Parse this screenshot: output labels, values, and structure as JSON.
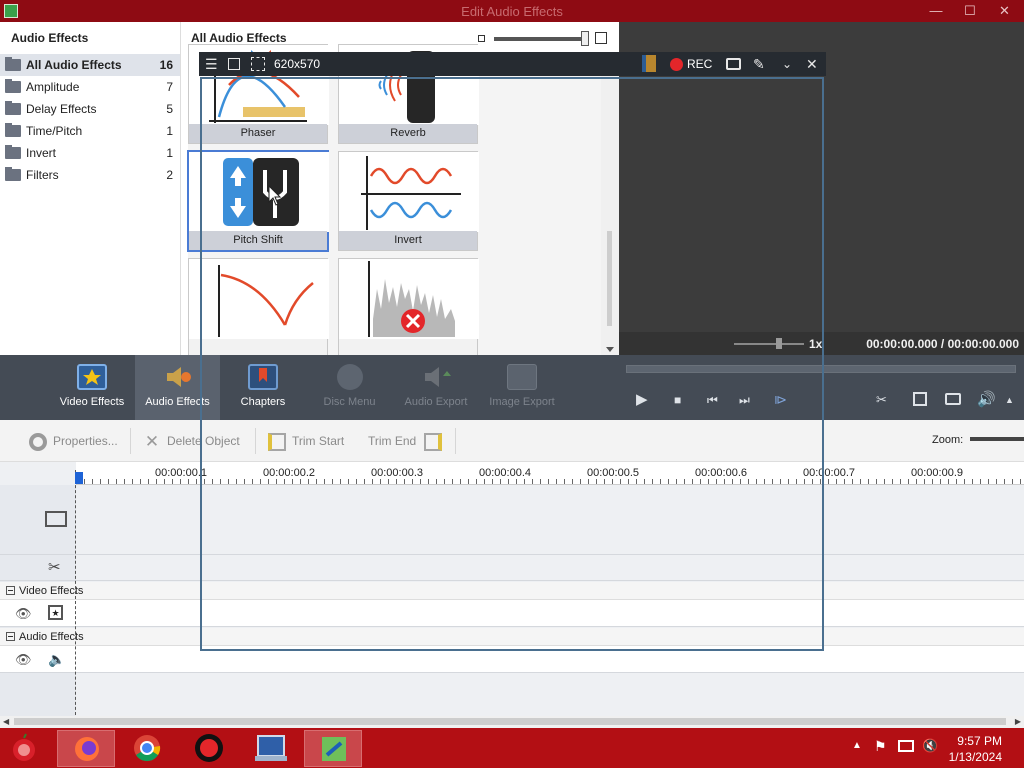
{
  "window": {
    "title": "Edit Audio Effects",
    "minimize": "—",
    "maximize": "☐",
    "close": "✕"
  },
  "categories": {
    "header": "Audio Effects",
    "items": [
      {
        "label": "All Audio Effects",
        "count": "16"
      },
      {
        "label": "Amplitude",
        "count": "7"
      },
      {
        "label": "Delay Effects",
        "count": "5"
      },
      {
        "label": "Time/Pitch",
        "count": "1"
      },
      {
        "label": "Invert",
        "count": "1"
      },
      {
        "label": "Filters",
        "count": "2"
      }
    ]
  },
  "effects": {
    "header": "All Audio Effects",
    "tiles": [
      {
        "label": "Phaser",
        "icon": "phaser-icon"
      },
      {
        "label": "Reverb",
        "icon": "reverb-icon"
      },
      {
        "label": "Pitch Shift",
        "icon": "tuning-fork-icon"
      },
      {
        "label": "Invert",
        "icon": "invert-wave-icon"
      },
      {
        "label": "",
        "icon": "filter-curve-icon"
      },
      {
        "label": "",
        "icon": "noise-remove-icon"
      }
    ]
  },
  "preview": {
    "speed": "1x",
    "time": "00:00:00.000 / 00:00:00.000"
  },
  "toolbar": {
    "tabs": [
      {
        "label": "Video Effects",
        "icon": "video-effects-icon"
      },
      {
        "label": "Audio Effects",
        "icon": "audio-effects-icon"
      },
      {
        "label": "Chapters",
        "icon": "chapters-icon"
      },
      {
        "label": "Disc Menu",
        "icon": "disc-menu-icon"
      },
      {
        "label": "Audio Export",
        "icon": "audio-export-icon"
      },
      {
        "label": "Image Export",
        "icon": "image-export-icon"
      }
    ],
    "controls": {
      "play": "▶",
      "stop": "■",
      "prev": "⏮",
      "next": "⏭",
      "frame": "⧐"
    }
  },
  "edit": {
    "properties": "Properties...",
    "delete": "Delete Object",
    "trim_start": "Trim Start",
    "trim_end": "Trim End",
    "zoom": "Zoom:"
  },
  "timeline": {
    "ticks": [
      "00:00:00.1",
      "00:00:00.2",
      "00:00:00.3",
      "00:00:00.4",
      "00:00:00.5",
      "00:00:00.6",
      "00:00:00.7",
      "00:00:00.9"
    ],
    "video_effects": "Video Effects",
    "audio_effects": "Audio Effects"
  },
  "recorder": {
    "size": "620x570",
    "rec": "REC"
  },
  "taskbar": {
    "time": "9:57 PM",
    "date": "1/13/2024"
  },
  "colors": {
    "titlebar": "#8e0b13",
    "taskbar": "#b30f14",
    "rec": "#e3262a",
    "accent": "#4a7bd4"
  }
}
